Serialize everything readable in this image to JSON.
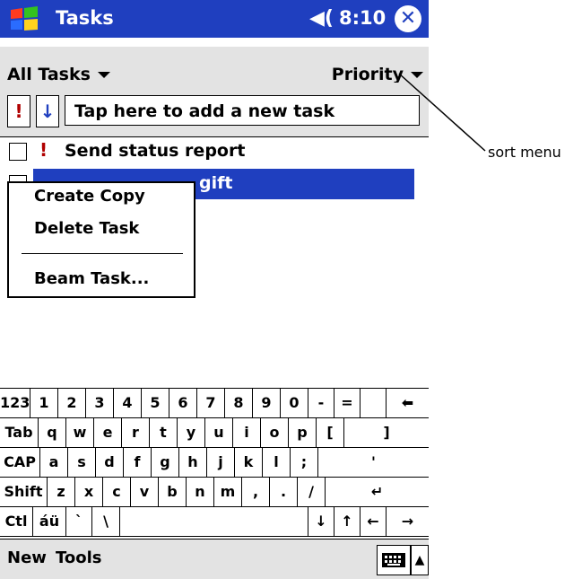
{
  "titlebar": {
    "app_title": "Tasks",
    "clock": "8:10",
    "speaker": "◀(",
    "close_symbol": "✕"
  },
  "filter": {
    "category": "All Tasks",
    "sort": "Priority"
  },
  "entry": {
    "priority_symbol": "!",
    "due_symbol": "↓",
    "placeholder": "Tap here to add a new task"
  },
  "tasks": [
    {
      "text": "Send status report",
      "priority": "!",
      "selected": false
    },
    {
      "text": "gift",
      "priority": "",
      "selected": true
    }
  ],
  "context_menu": {
    "items": [
      "Create Copy",
      "Delete Task",
      "Beam Task..."
    ]
  },
  "keyboard": {
    "rows": [
      [
        "123",
        "1",
        "2",
        "3",
        "4",
        "5",
        "6",
        "7",
        "8",
        "9",
        "0",
        "-",
        "=",
        "⬅"
      ],
      [
        "Tab",
        "q",
        "w",
        "e",
        "r",
        "t",
        "y",
        "u",
        "i",
        "o",
        "p",
        "[",
        "]"
      ],
      [
        "CAP",
        "a",
        "s",
        "d",
        "f",
        "g",
        "h",
        "j",
        "k",
        "l",
        ";",
        "'"
      ],
      [
        "Shift",
        "z",
        "x",
        "c",
        "v",
        "b",
        "n",
        "m",
        ",",
        ".",
        "/",
        "↵"
      ],
      [
        "Ctl",
        "áü",
        "`",
        "\\",
        "",
        "↓",
        "↑",
        "←",
        "→"
      ]
    ]
  },
  "bottom_menu": {
    "new": "New",
    "tools": "Tools"
  },
  "callout": {
    "label": "sort menu"
  },
  "colors": {
    "titlebar": "#1f3fbf",
    "selection": "#1f3fbf",
    "priority": "#b00000"
  },
  "icons": [
    "windows-start-icon",
    "speaker-icon",
    "close-icon",
    "caret-down-icon",
    "keyboard-icon"
  ]
}
